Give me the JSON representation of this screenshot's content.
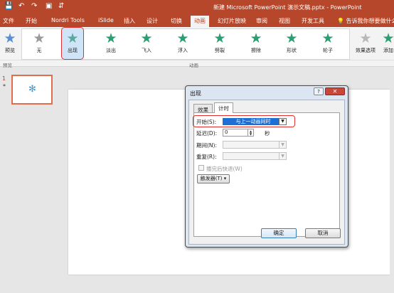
{
  "titlebar": {
    "save_icon": "save-icon",
    "undo_icon": "undo-icon",
    "redo_icon": "redo-icon",
    "present_icon": "present-from-start-icon",
    "title": "新建 Microsoft PowerPoint 演示文稿.pptx  -  PowerPoint"
  },
  "menu": {
    "tabs": [
      "文件",
      "开始",
      "Nordri Tools",
      "iSlide",
      "插入",
      "设计",
      "切换",
      "动画",
      "幻灯片放映",
      "审阅",
      "视图",
      "开发工具"
    ],
    "active": "动画",
    "help": "告诉我你想要做什么"
  },
  "ribbon": {
    "preview_label": "预览",
    "effects": [
      "无",
      "出现",
      "淡出",
      "飞入",
      "浮入",
      "劈裂",
      "擦除",
      "形状",
      "轮子"
    ],
    "effect_options_label": "效果选项",
    "add_label": "添加",
    "group_preview": "预览",
    "group_animation": "动画"
  },
  "thumbnails": {
    "slide_number": "1",
    "star": "*"
  },
  "dialog": {
    "title": "出现",
    "help_btn": "?",
    "close_btn": "✕",
    "tabs": [
      "效果",
      "计时"
    ],
    "start_label": "开始(S):",
    "start_value": "与上一动画同时",
    "delay_label": "延迟(D):",
    "delay_value": "0",
    "delay_unit": "秒",
    "period_label": "期间(N):",
    "repeat_label": "重复(R):",
    "rewind_label": "播完后快退(W)",
    "trigger_label": "触发器(T) ▾",
    "ok_label": "确定",
    "cancel_label": "取消"
  },
  "colors": {
    "accent": "#b7472a",
    "star_green": "#2e9e72",
    "star_selected": "#5b8fd2",
    "selection_blue": "#1e6fd4",
    "highlight_red": "#e03030"
  }
}
